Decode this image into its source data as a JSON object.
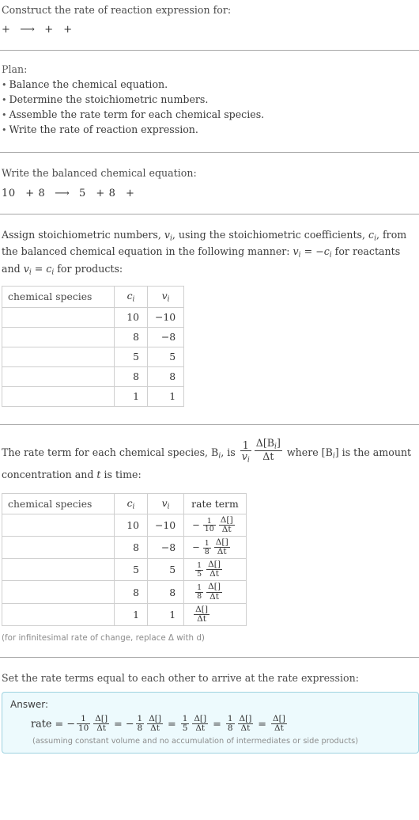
{
  "header": {
    "prompt": "Construct the rate of reaction expression for:",
    "equation_tokens": [
      "+",
      "⟶",
      "+",
      "+"
    ]
  },
  "plan": {
    "title": "Plan:",
    "items": [
      "Balance the chemical equation.",
      "Determine the stoichiometric numbers.",
      "Assemble the rate term for each chemical species.",
      "Write the rate of reaction expression."
    ]
  },
  "balanced": {
    "lead": "Write the balanced chemical equation:",
    "equation": {
      "reactant_1_coeff": "10",
      "plus_1": "+",
      "reactant_2_coeff": "8",
      "arrow": "⟶",
      "product_1_coeff": "5",
      "plus_2": "+",
      "product_2_coeff": "8",
      "plus_3": "+"
    }
  },
  "stoich": {
    "para_1": "Assign stoichiometric numbers, ",
    "para_2": ", using the stoichiometric coefficients, ",
    "para_3": ", from the balanced chemical equation in the following manner: ",
    "para_4": " for reactants and ",
    "para_5": " for products:",
    "v_i": "v",
    "c_i": "c",
    "sub_i": "i",
    "rel_reactants": "v",
    "rel_products": "v",
    "table": {
      "headers": {
        "species": "chemical species",
        "c": "c",
        "v": "v",
        "sub": "i"
      },
      "rows": [
        {
          "species": "",
          "c": "10",
          "v": "−10"
        },
        {
          "species": "",
          "c": "8",
          "v": "−8"
        },
        {
          "species": "",
          "c": "5",
          "v": "5"
        },
        {
          "species": "",
          "c": "8",
          "v": "8"
        },
        {
          "species": "",
          "c": "1",
          "v": "1"
        }
      ]
    }
  },
  "rateterm": {
    "para_1": "The rate term for each chemical species, ",
    "B": "B",
    "sub_i": "i",
    "para_2": ", is ",
    "frac_one": "1",
    "frac_v": "v",
    "frac_num_delta": "Δ[B",
    "frac_num_close": "]",
    "frac_den": "Δt",
    "para_3": " where [B",
    "para_4": "] is the amount concentration and ",
    "t": "t",
    "para_5": " is time:",
    "table": {
      "headers": {
        "species": "chemical species",
        "c": "c",
        "v": "v",
        "sub": "i",
        "rate": "rate term"
      },
      "rows": [
        {
          "species": "",
          "c": "10",
          "v": "−10",
          "sign": "−",
          "one": "1",
          "denom": "10",
          "num": "Δ[]",
          "den": "Δt"
        },
        {
          "species": "",
          "c": "8",
          "v": "−8",
          "sign": "−",
          "one": "1",
          "denom": "8",
          "num": "Δ[]",
          "den": "Δt"
        },
        {
          "species": "",
          "c": "5",
          "v": "5",
          "sign": "",
          "one": "1",
          "denom": "5",
          "num": "Δ[]",
          "den": "Δt"
        },
        {
          "species": "",
          "c": "8",
          "v": "8",
          "sign": "",
          "one": "1",
          "denom": "8",
          "num": "Δ[]",
          "den": "Δt"
        },
        {
          "species": "",
          "c": "1",
          "v": "1",
          "sign": "",
          "one": "",
          "denom": "",
          "num": "Δ[]",
          "den": "Δt"
        }
      ]
    },
    "note": "(for infinitesimal rate of change, replace Δ with d)"
  },
  "final": {
    "lead": "Set the rate terms equal to each other to arrive at the rate expression:",
    "answer_label": "Answer:",
    "rate_label": "rate",
    "equals": "=",
    "terms": [
      {
        "sign": "−",
        "one": "1",
        "denom": "10",
        "num": "Δ[]",
        "den": "Δt"
      },
      {
        "sign": "−",
        "one": "1",
        "denom": "8",
        "num": "Δ[]",
        "den": "Δt"
      },
      {
        "sign": "",
        "one": "1",
        "denom": "5",
        "num": "Δ[]",
        "den": "Δt"
      },
      {
        "sign": "",
        "one": "1",
        "denom": "8",
        "num": "Δ[]",
        "den": "Δt"
      },
      {
        "sign": "",
        "one": "",
        "denom": "",
        "num": "Δ[]",
        "den": "Δt"
      }
    ],
    "assumption": "(assuming constant volume and no accumulation of intermediates or side products)"
  },
  "colors": {
    "divider": "#a8a8a8",
    "table_border": "#cfcfcf",
    "answer_border": "#9ed2e0",
    "answer_bg": "#edfafd",
    "text": "#3c3c3c",
    "muted": "#8c8c8c"
  }
}
